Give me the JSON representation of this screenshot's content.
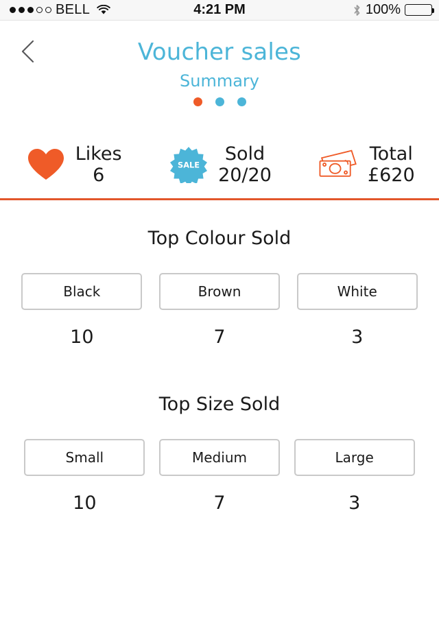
{
  "statusbar": {
    "carrier": "BELL",
    "signal_filled": 3,
    "signal_total": 5,
    "wifi_icon": "wifi-icon",
    "time": "4:21 PM",
    "bluetooth_icon": "bluetooth-icon",
    "battery_percent": "100%",
    "battery_level": 100
  },
  "header": {
    "back_icon": "chevron-left-icon",
    "title": "Voucher sales",
    "subtitle": "Summary",
    "pager": {
      "count": 3,
      "active_index": 0
    }
  },
  "stats": [
    {
      "icon": "heart-icon",
      "label": "Likes",
      "value": "6"
    },
    {
      "icon": "sale-badge-icon",
      "badge_text": "SALE",
      "label": "Sold",
      "value": "20/20"
    },
    {
      "icon": "money-icon",
      "label": "Total",
      "value": "£620"
    }
  ],
  "sections": [
    {
      "title": "Top Colour Sold",
      "items": [
        {
          "label": "Black",
          "value": "10"
        },
        {
          "label": "Brown",
          "value": "7"
        },
        {
          "label": "White",
          "value": "3"
        }
      ]
    },
    {
      "title": "Top Size Sold",
      "items": [
        {
          "label": "Small",
          "value": "10"
        },
        {
          "label": "Medium",
          "value": "7"
        },
        {
          "label": "Large",
          "value": "3"
        }
      ]
    }
  ],
  "colors": {
    "accent_cyan": "#4cb5d8",
    "accent_orange": "#ef5b28",
    "divider_orange": "#e2562a",
    "chip_border": "#c9c9c9",
    "text_dark": "#1a1a1a"
  }
}
